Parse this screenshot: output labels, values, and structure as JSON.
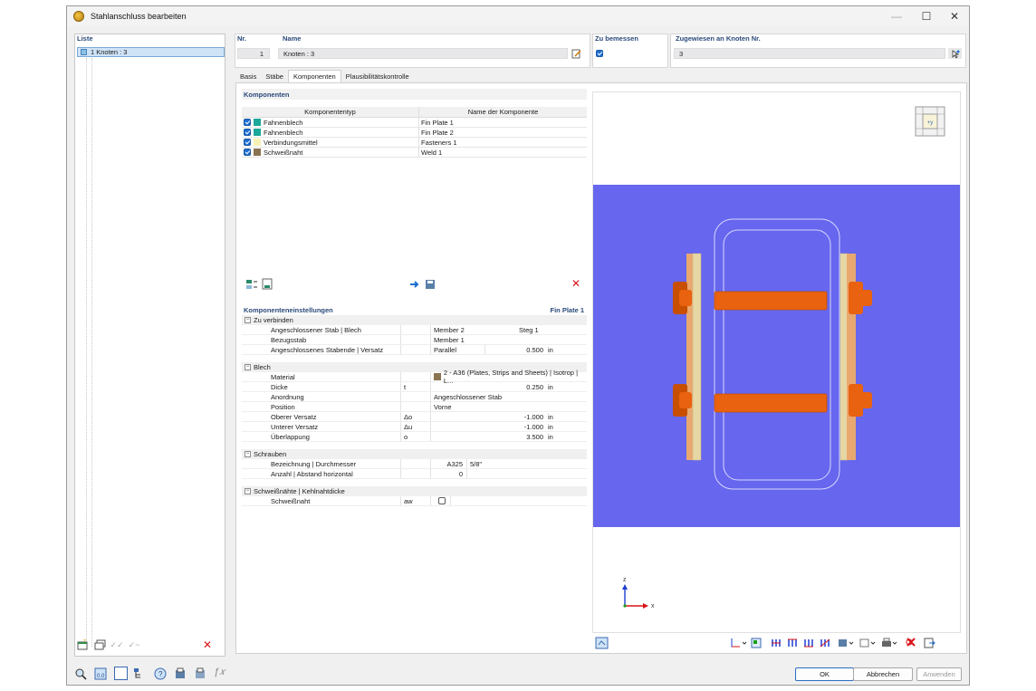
{
  "window": {
    "title": "Stahlanschluss bearbeiten"
  },
  "list": {
    "header": "Liste",
    "items": [
      {
        "label": "1  Knoten : 3"
      }
    ]
  },
  "header": {
    "nr_label": "Nr.",
    "nr_value": "1",
    "name_label": "Name",
    "name_value": "Knoten : 3",
    "design_label": "Zu bemessen",
    "assigned_label": "Zugewiesen an Knoten Nr.",
    "assigned_value": "3"
  },
  "tabs": [
    {
      "label": "Basis"
    },
    {
      "label": "Stäbe"
    },
    {
      "label": "Komponenten"
    },
    {
      "label": "Plausibilitätskontrolle"
    }
  ],
  "components": {
    "title": "Komponenten",
    "col_type": "Komponententyp",
    "col_name": "Name der Komponente",
    "rows": [
      {
        "type": "Fahnenblech",
        "name": "Fin Plate 1",
        "color": "#1aa89a"
      },
      {
        "type": "Fahnenblech",
        "name": "Fin Plate 2",
        "color": "#1aa89a"
      },
      {
        "type": "Verbindungsmittel",
        "name": "Fasteners 1",
        "color": "#f6f2b4"
      },
      {
        "type": "Schweißnaht",
        "name": "Weld 1",
        "color": "#8a7450"
      }
    ]
  },
  "settings": {
    "title": "Komponenteneinstellungen",
    "current": "Fin Plate 1",
    "groups": {
      "connect": {
        "label": "Zu verbinden",
        "rows": [
          {
            "name": "Angeschlossener Stab | Blech",
            "v1": "Member 2",
            "v2": "Steg 1"
          },
          {
            "name": "Bezugsstab",
            "v1": "Member 1"
          },
          {
            "name": "Angeschlossenes Stabende | Versatz",
            "v1": "Parallel",
            "v2": "0.500",
            "unit": "in"
          }
        ]
      },
      "plate": {
        "label": "Blech",
        "rows": [
          {
            "name": "Material",
            "v1": "2 - A36 (Plates, Strips and Sheets) | Isotrop | L...",
            "swatch": "#8a7450"
          },
          {
            "name": "Dicke",
            "sym": "t",
            "v1": "0.250",
            "unit": "in"
          },
          {
            "name": "Anordnung",
            "v1": "Angeschlossener Stab"
          },
          {
            "name": "Position",
            "v1": "Vorne"
          },
          {
            "name": "Oberer Versatz",
            "sym": "Δo",
            "v1": "-1.000",
            "unit": "in"
          },
          {
            "name": "Unterer Versatz",
            "sym": "Δu",
            "v1": "-1.000",
            "unit": "in"
          },
          {
            "name": "Überlappung",
            "sym": "o",
            "v1": "3.500",
            "unit": "in"
          }
        ]
      },
      "bolts": {
        "label": "Schrauben",
        "rows": [
          {
            "name": "Bezeichnung | Durchmesser",
            "v1": "A325",
            "v2": "5/8\""
          },
          {
            "name": "Anzahl | Abstand horizontal",
            "v1": "0"
          }
        ]
      },
      "welds": {
        "label": "Schweißnähte | Kehlnahtdicke",
        "rows": [
          {
            "name": "Schweißnaht",
            "sym": "aw"
          }
        ]
      }
    }
  },
  "viewport": {
    "view_cube_label": "+y",
    "axis_z": "z",
    "axis_x": "x"
  },
  "buttons": {
    "ok": "OK",
    "cancel": "Abbrechen",
    "apply": "Anwenden"
  },
  "colors": {
    "accent": "#2a4a7a",
    "viewport_bg": "#6666ee",
    "bolt": "#e8620f",
    "plate": "#e6d7a5"
  }
}
